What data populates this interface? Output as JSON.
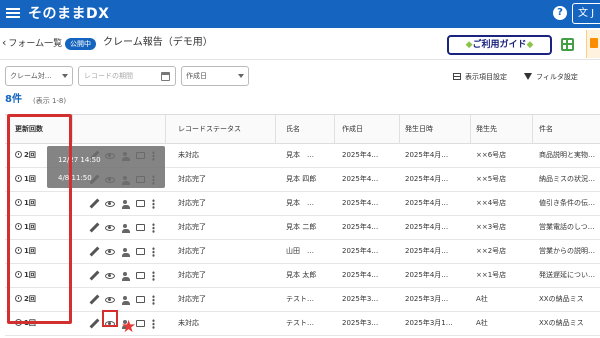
{
  "app": {
    "logo": "そのままDX",
    "help": "?",
    "lang": "文 J"
  },
  "subheader": {
    "back_label": "フォーム一覧",
    "status_badge": "公開中",
    "form_title": "クレーム報告（デモ用）",
    "guide_label": "ご利用ガイド"
  },
  "filters": {
    "category": "クレーム対…",
    "date_placeholder": "レコードの期間",
    "created_date": "作成日"
  },
  "tools": {
    "display_settings": "表示項目設定",
    "filter_settings": "フィルタ設定"
  },
  "summary": {
    "count": "8件",
    "range": "(表示 1-8)"
  },
  "columns": {
    "update_count": "更新回数",
    "record_status": "レコードステータス",
    "name": "氏名",
    "created": "作成日",
    "occurred_at": "発生日時",
    "location": "発生先",
    "subject": "件名"
  },
  "rows": [
    {
      "updates": "2回",
      "status": "未対応",
      "name": "見本　…",
      "created": "2025年4…",
      "occurred": "2025年4月…",
      "location": "××6号店",
      "subject": "商品説明と実物…"
    },
    {
      "updates": "1回",
      "status": "対応完了",
      "name": "見本 四郎",
      "created": "2025年4…",
      "occurred": "2025年4月…",
      "location": "××5号店",
      "subject": "納品ミスの状況…"
    },
    {
      "updates": "1回",
      "status": "対応完了",
      "name": "見本　…",
      "created": "2025年4…",
      "occurred": "2025年4月…",
      "location": "××4号店",
      "subject": "値引き条件の伝…"
    },
    {
      "updates": "1回",
      "status": "対応完了",
      "name": "見本 二郎",
      "created": "2025年4…",
      "occurred": "2025年4月…",
      "location": "××3号店",
      "subject": "営業電話のしつ…"
    },
    {
      "updates": "1回",
      "status": "対応完了",
      "name": "山田　…",
      "created": "2025年4…",
      "occurred": "2025年4月…",
      "location": "××2号店",
      "subject": "営業からの説明…"
    },
    {
      "updates": "1回",
      "status": "対応完了",
      "name": "見本 太郎",
      "created": "2025年4…",
      "occurred": "2025年4月…",
      "location": "××1号店",
      "subject": "発送遅延につい…"
    },
    {
      "updates": "2回",
      "status": "対応完了",
      "name": "テスト…",
      "created": "2025年3…",
      "occurred": "2025年3月…",
      "location": "A社",
      "subject": "XXの納品ミス"
    },
    {
      "updates": "1回",
      "status": "未対応",
      "name": "テスト…",
      "created": "2025年3…",
      "occurred": "2025年3月1…",
      "location": "A社",
      "subject": "XXの納品ミス"
    }
  ],
  "tooltip": {
    "line1": "12/27 14:50",
    "line2": "4/8 11:50"
  },
  "annotation": {
    "star": "★"
  }
}
